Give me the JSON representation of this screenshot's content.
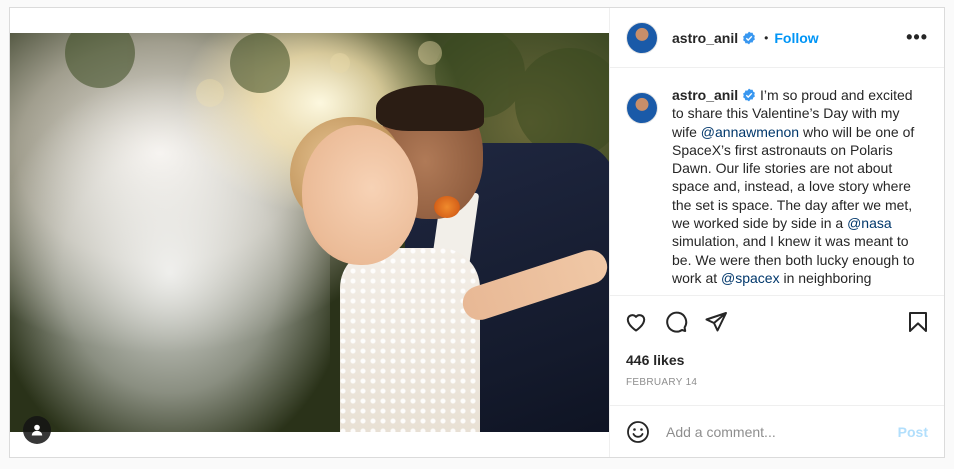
{
  "post": {
    "username": "astro_anil",
    "separator": "•",
    "follow_label": "Follow",
    "more_label": "•••",
    "caption": {
      "username": "astro_anil",
      "part1": "I’m so proud and excited to share this Valentine’s Day with my wife ",
      "mention1": "@annawmenon",
      "part2": " who will be one of SpaceX’s first astronauts on Polaris Dawn. Our life stories are not about space and, instead, a love story where the set is space. The day after we met, we worked side by side in a ",
      "mention2": "@nasa",
      "part3": " simulation, and I knew it was meant to be. We were then both lucky enough to work at ",
      "mention3": "@spacex",
      "part4": " in neighboring"
    },
    "likes": "446 likes",
    "date": "FEBRUARY 14",
    "comment_placeholder": "Add a comment...",
    "post_label": "Post",
    "icons": {
      "like": "heart-icon",
      "comment": "comment-icon",
      "share": "paper-plane-icon",
      "save": "bookmark-icon",
      "emoji": "smiley-icon",
      "tag": "user-tag-icon",
      "verified": "verified-badge-icon"
    },
    "colors": {
      "link": "#0095f6",
      "mention": "#00376b",
      "post_disabled": "#b2dffc",
      "muted": "#8e8e8e"
    }
  }
}
